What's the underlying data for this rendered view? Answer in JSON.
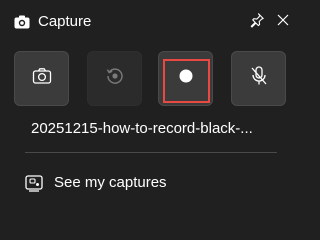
{
  "header": {
    "title": "Capture",
    "icon": "camera-icon",
    "pin_icon": "pin-icon",
    "close_icon": "close-icon"
  },
  "buttons": [
    {
      "id": "screenshot",
      "icon": "camera-icon",
      "state": "enabled"
    },
    {
      "id": "record-last",
      "icon": "replay-icon",
      "state": "disabled"
    },
    {
      "id": "start-recording",
      "icon": "record-icon",
      "state": "enabled",
      "highlighted": true
    },
    {
      "id": "microphone",
      "icon": "mic-off-icon",
      "state": "muted"
    }
  ],
  "last_capture": {
    "filename": "20251215-how-to-record-black-..."
  },
  "footer": {
    "link_label": "See my captures",
    "link_icon": "gallery-icon"
  },
  "colors": {
    "panel_bg": "#202020",
    "button_bg": "#3b3b3b",
    "highlight": "#e84a43",
    "text": "#ffffff"
  }
}
